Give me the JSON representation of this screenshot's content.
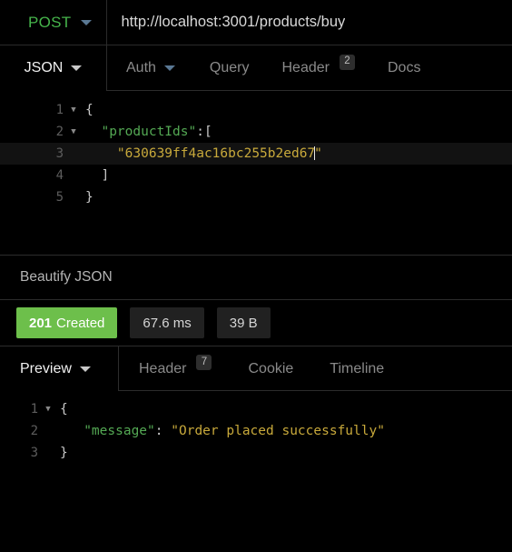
{
  "request": {
    "method": "POST",
    "method_color": "#46b54b",
    "url": "http://localhost:3001/products/buy",
    "tabs": [
      {
        "label": "JSON",
        "badge": null,
        "dropdown": true,
        "active": true
      },
      {
        "label": "Auth",
        "badge": null,
        "dropdown": true,
        "active": false
      },
      {
        "label": "Query",
        "badge": null,
        "dropdown": false,
        "active": false
      },
      {
        "label": "Header",
        "badge": "2",
        "dropdown": false,
        "active": false
      },
      {
        "label": "Docs",
        "badge": null,
        "dropdown": false,
        "active": false
      }
    ],
    "body_lines": [
      {
        "number": "1",
        "fold": true,
        "active": false,
        "tokens": [
          {
            "text": "{",
            "type": "punct"
          }
        ]
      },
      {
        "number": "2",
        "fold": true,
        "active": false,
        "tokens": [
          {
            "text": "  ",
            "type": "punct"
          },
          {
            "text": "\"productIds\"",
            "type": "key"
          },
          {
            "text": ":[",
            "type": "punct"
          }
        ]
      },
      {
        "number": "3",
        "fold": false,
        "active": true,
        "tokens": [
          {
            "text": "    ",
            "type": "punct"
          },
          {
            "text": "\"630639ff4ac16bc255b2ed67",
            "type": "string"
          },
          {
            "text": "CARET",
            "type": "caret"
          },
          {
            "text": "\"",
            "type": "string"
          }
        ]
      },
      {
        "number": "4",
        "fold": false,
        "active": false,
        "tokens": [
          {
            "text": "  ]",
            "type": "punct"
          }
        ]
      },
      {
        "number": "5",
        "fold": false,
        "active": false,
        "tokens": [
          {
            "text": "}",
            "type": "punct"
          }
        ]
      }
    ]
  },
  "response": {
    "beautify_label": "Beautify JSON",
    "status_code": "201",
    "status_text": "Created",
    "status_color": "#6dbf4b",
    "time": "67.6 ms",
    "size": "39 B",
    "tabs": [
      {
        "label": "Preview",
        "badge": null,
        "dropdown": true,
        "active": true
      },
      {
        "label": "Header",
        "badge": "7",
        "dropdown": false,
        "active": false
      },
      {
        "label": "Cookie",
        "badge": null,
        "dropdown": false,
        "active": false
      },
      {
        "label": "Timeline",
        "badge": null,
        "dropdown": false,
        "active": false
      }
    ],
    "body_lines": [
      {
        "number": "1",
        "fold": true,
        "active": false,
        "tokens": [
          {
            "text": "{",
            "type": "punct"
          }
        ]
      },
      {
        "number": "2",
        "fold": false,
        "active": false,
        "tokens": [
          {
            "text": "   ",
            "type": "punct"
          },
          {
            "text": "\"message\"",
            "type": "key"
          },
          {
            "text": ": ",
            "type": "punct"
          },
          {
            "text": "\"Order placed successfully\"",
            "type": "string"
          }
        ]
      },
      {
        "number": "3",
        "fold": false,
        "active": false,
        "tokens": [
          {
            "text": "}",
            "type": "punct"
          }
        ]
      }
    ]
  },
  "icons": {
    "chevron_down": "chevron-down-icon",
    "fold_arrow": "fold-arrow-icon"
  }
}
